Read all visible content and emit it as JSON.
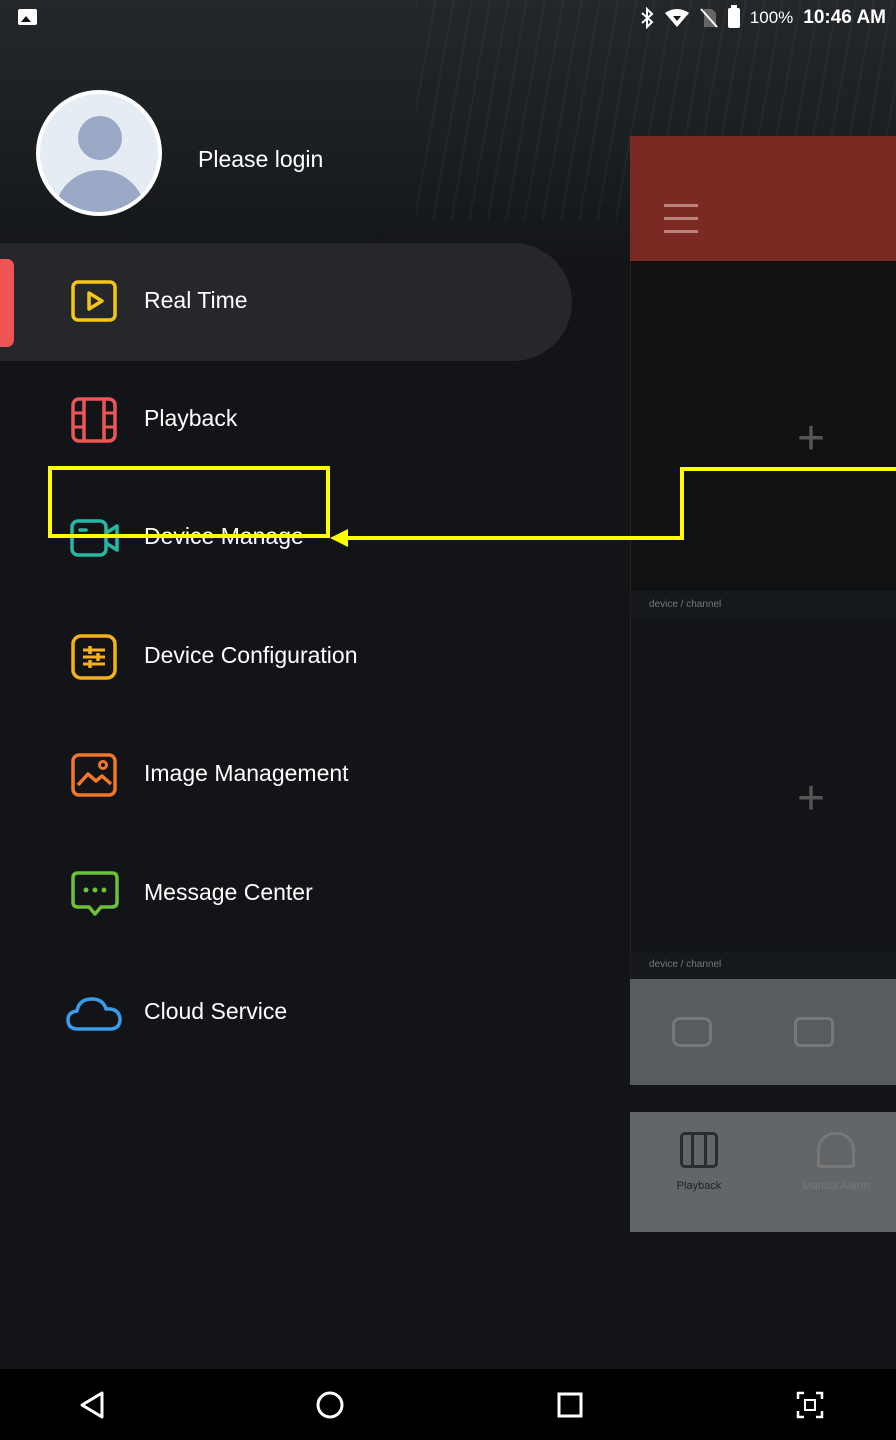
{
  "status_bar": {
    "battery_percent": "100%",
    "time": "10:46 AM",
    "icons": [
      "gallery-icon",
      "bluetooth-icon",
      "wifi-icon",
      "no-sim-icon",
      "battery-icon"
    ]
  },
  "drawer": {
    "login_text": "Please login",
    "menu": [
      {
        "label": "Real Time",
        "icon": "play-icon",
        "color": "#f5c518",
        "active": true
      },
      {
        "label": "Playback",
        "icon": "film-icon",
        "color": "#ee5656",
        "active": false
      },
      {
        "label": "Device Manage",
        "icon": "camera-icon",
        "color": "#2bb6a3",
        "active": false
      },
      {
        "label": "Device Configuration",
        "icon": "sliders-icon",
        "color": "#f5b21a",
        "active": false
      },
      {
        "label": "Image Management",
        "icon": "image-icon",
        "color": "#f2772a",
        "active": false
      },
      {
        "label": "Message Center",
        "icon": "message-icon",
        "color": "#6cc03a",
        "active": false
      },
      {
        "label": "Cloud Service",
        "icon": "cloud-icon",
        "color": "#3a9be8",
        "active": false
      }
    ],
    "active_indicator_color": "#ee5656",
    "highlight_color": "#ffff00"
  },
  "background_app": {
    "header_color": "#7a2a22",
    "cell_caption_1": "device / channel",
    "cell_caption_2": "device / channel",
    "tabs": [
      {
        "label": "Playback",
        "icon": "film-icon"
      },
      {
        "label": "Manual Alarm",
        "icon": "alarm-icon"
      }
    ]
  },
  "nav_bar": {
    "buttons": [
      "back-icon",
      "home-icon",
      "recents-icon",
      "screenshot-icon"
    ]
  }
}
